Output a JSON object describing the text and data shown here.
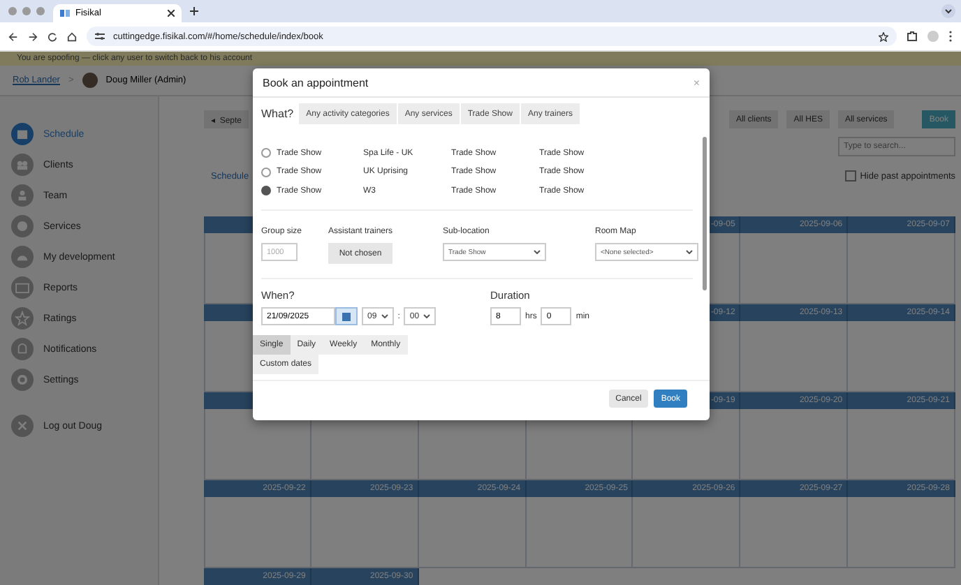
{
  "browser": {
    "tab_title": "Fisikal",
    "url": "cuttingedge.fisikal.com/#/home/schedule/index/book"
  },
  "spoof_banner": "You are spoofing — click any user to switch back to his account",
  "breadcrumb": {
    "link": "Rob Lander",
    "separator": ">",
    "user": "Doug Miller (Admin)"
  },
  "sidebar": {
    "items": [
      {
        "label": "Schedule",
        "selected": true
      },
      {
        "label": "Clients",
        "selected": false
      },
      {
        "label": "Team",
        "selected": false
      },
      {
        "label": "Services",
        "selected": false
      },
      {
        "label": "My development",
        "selected": false
      },
      {
        "label": "Reports",
        "selected": false
      },
      {
        "label": "Ratings",
        "selected": false
      },
      {
        "label": "Notifications",
        "selected": false
      },
      {
        "label": "Settings",
        "selected": false
      }
    ],
    "logout": "Log out Doug"
  },
  "toolbar": {
    "prev": "◂",
    "month": "Septe",
    "filters": [
      "All clients",
      "All HES",
      "All services"
    ],
    "book": "Book",
    "search_placeholder": "Type to search...",
    "schedule_link": "Schedule",
    "hide_past": {
      "label": "Hide past appointments",
      "checked": false
    }
  },
  "calendar": {
    "weeks": [
      {
        "kind": "covered",
        "dates": [
          "-09-05",
          "2025-09-06",
          "2025-09-07"
        ]
      },
      {
        "kind": "covered",
        "dates": [
          "-09-12",
          "2025-09-13",
          "2025-09-14"
        ]
      },
      {
        "kind": "covered",
        "dates": [
          "-09-19",
          "2025-09-20",
          "2025-09-21"
        ]
      },
      {
        "kind": "open",
        "dates": [
          "2025-09-22",
          "2025-09-23",
          "2025-09-24",
          "2025-09-25",
          "2025-09-26",
          "2025-09-27",
          "2025-09-28"
        ]
      },
      {
        "kind": "open",
        "dates": [
          "2025-09-29",
          "2025-09-30"
        ]
      }
    ]
  },
  "modal": {
    "title": "Book an appointment",
    "close": "×",
    "what_label": "What?",
    "filter_tabs": [
      "Any activity categories",
      "Any services",
      "Trade Show",
      "Any trainers"
    ],
    "rows": [
      {
        "selected": false,
        "cells": [
          "Trade Show",
          "Spa Life - UK",
          "Trade Show",
          "Trade Show"
        ]
      },
      {
        "selected": false,
        "cells": [
          "Trade Show",
          "UK Uprising",
          "Trade Show",
          "Trade Show"
        ]
      },
      {
        "selected": true,
        "cells": [
          "Trade Show",
          "W3",
          "Trade Show",
          "Trade Show"
        ]
      }
    ],
    "group_size": {
      "label": "Group size",
      "placeholder": "1000"
    },
    "assistant_trainers": {
      "label": "Assistant trainers",
      "value": "Not chosen"
    },
    "sub_location": {
      "label": "Sub-location",
      "value": "Trade Show"
    },
    "room_map": {
      "label": "Room Map",
      "value": "<None selected>"
    },
    "when": {
      "label": "When?",
      "date": "21/09/2025",
      "hour": "09",
      "separator": ":",
      "minute": "00"
    },
    "duration": {
      "label": "Duration",
      "hours": "8",
      "hours_unit": "hrs",
      "minutes": "0",
      "minutes_unit": "min"
    },
    "repeat": [
      {
        "label": "Single",
        "selected": true
      },
      {
        "label": "Daily",
        "selected": false
      },
      {
        "label": "Weekly",
        "selected": false
      },
      {
        "label": "Monthly",
        "selected": false
      },
      {
        "label": "Custom dates",
        "selected": false
      }
    ],
    "cancel": "Cancel",
    "book": "Book"
  }
}
